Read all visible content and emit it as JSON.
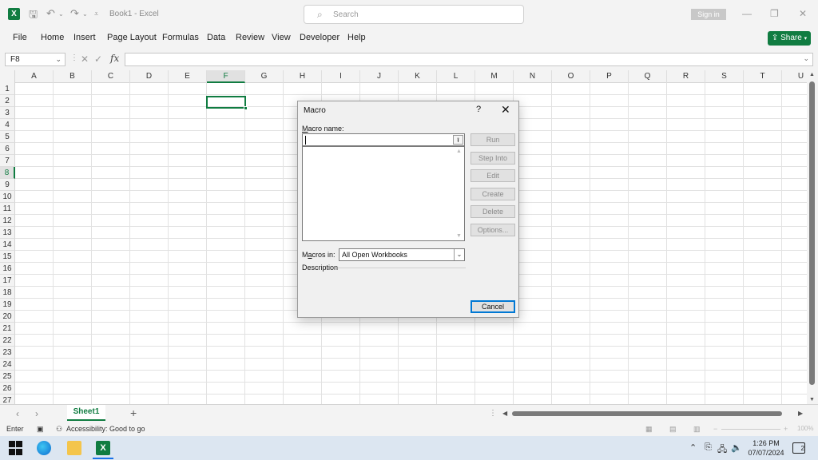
{
  "titlebar": {
    "doc_title": "Book1  -  Excel",
    "search_placeholder": "Search",
    "signin_label": "Sign in",
    "minimize": "—",
    "restore": "❐",
    "close": "✕"
  },
  "menu": {
    "items": [
      "File",
      "Home",
      "Insert",
      "Page Layout",
      "Formulas",
      "Data",
      "Review",
      "View",
      "Developer",
      "Help"
    ],
    "share_label": "Share"
  },
  "formula_bar": {
    "name_box": "F8",
    "fx_label": "fx",
    "formula_value": ""
  },
  "grid": {
    "columns": [
      "A",
      "B",
      "C",
      "D",
      "E",
      "F",
      "G",
      "H",
      "I",
      "J",
      "K",
      "L",
      "M",
      "N",
      "O",
      "P",
      "Q",
      "R",
      "S",
      "T",
      "U"
    ],
    "rows": [
      "1",
      "2",
      "3",
      "4",
      "5",
      "6",
      "7",
      "8",
      "9",
      "10",
      "11",
      "12",
      "13",
      "14",
      "15",
      "16",
      "17",
      "18",
      "19",
      "20",
      "21",
      "22",
      "23",
      "24",
      "25",
      "26",
      "27"
    ],
    "selected_column": "F",
    "selected_row": "8"
  },
  "sheets": {
    "tabs": [
      "Sheet1"
    ],
    "add_label": "+"
  },
  "status": {
    "mode": "Enter",
    "accessibility": "Accessibility: Good to go",
    "zoom": "100%"
  },
  "taskbar": {
    "time": "1:26 PM",
    "date": "07/07/2024",
    "notification_count": "2"
  },
  "dialog": {
    "title": "Macro",
    "help": "?",
    "close": "✕",
    "macro_name_label_underlined": "M",
    "macro_name_label_rest": "acro name:",
    "macro_name_value": "",
    "buttons": {
      "run": "Run",
      "step_into": "Step Into",
      "edit": "Edit",
      "create": "Create",
      "delete": "Delete",
      "options": "Options...",
      "cancel": "Cancel"
    },
    "macros_in_label_pre": "M",
    "macros_in_label_underlined": "a",
    "macros_in_label_rest": "cros in:",
    "macros_in_value": "All Open Workbooks",
    "description_label": "Description"
  },
  "colors": {
    "excel_green": "#107c41",
    "focus_blue": "#0078d4"
  }
}
